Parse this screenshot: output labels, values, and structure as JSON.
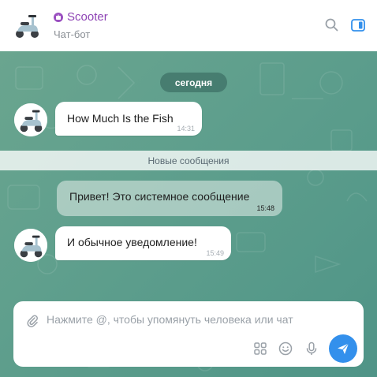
{
  "header": {
    "bot_name": "Scooter",
    "bot_subtitle": "Чат-бот",
    "badge_icon": "bot-icon",
    "badge_color": "#9a4fc0",
    "actions": [
      "search-icon",
      "panel-toggle-icon"
    ],
    "accent_color": "#3390ec"
  },
  "chat": {
    "date_label": "сегодня",
    "background_color": "#5f9f8d",
    "new_messages_label": "Новые сообщения",
    "messages": [
      {
        "type": "incoming",
        "text": "How Much Is the Fish",
        "time": "14:31"
      },
      {
        "type": "system",
        "text": "Привет! Это системное сообщение",
        "time": "15:48"
      },
      {
        "type": "incoming",
        "text": "И обычное уведомление!",
        "time": "15:49"
      }
    ]
  },
  "composer": {
    "placeholder": "Нажмите @, чтобы упомянуть человека или чат",
    "icons": [
      "attach-icon",
      "apps-icon",
      "emoji-icon",
      "microphone-icon",
      "send-icon"
    ],
    "send_color": "#3390ec"
  }
}
